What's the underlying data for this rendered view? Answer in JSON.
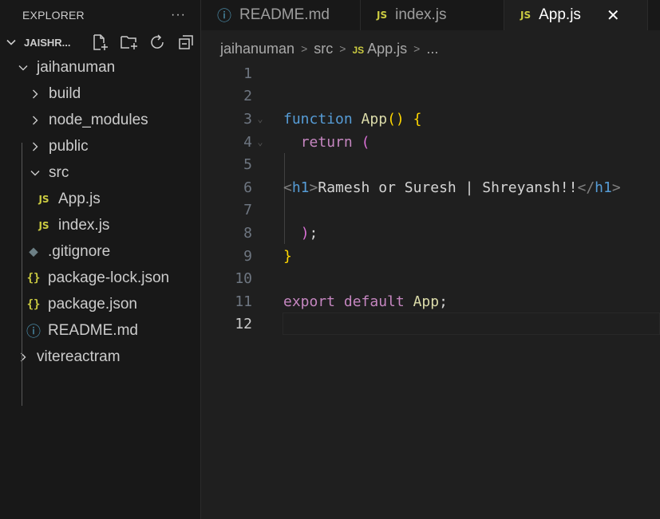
{
  "sidebar": {
    "title": "EXPLORER",
    "more": "···",
    "workspace": "JAISHR...",
    "tree": [
      {
        "label": "jaihanuman",
        "kind": "folder-open",
        "depth": 1
      },
      {
        "label": "build",
        "kind": "folder",
        "depth": 2
      },
      {
        "label": "node_modules",
        "kind": "folder",
        "depth": 2
      },
      {
        "label": "public",
        "kind": "folder",
        "depth": 2
      },
      {
        "label": "src",
        "kind": "folder-open",
        "depth": 2
      },
      {
        "label": "App.js",
        "kind": "js",
        "depth": 3
      },
      {
        "label": "index.js",
        "kind": "js",
        "depth": 3
      },
      {
        "label": ".gitignore",
        "kind": "git",
        "depth": 2
      },
      {
        "label": "package-lock.json",
        "kind": "json",
        "depth": 2
      },
      {
        "label": "package.json",
        "kind": "json",
        "depth": 2
      },
      {
        "label": "README.md",
        "kind": "info",
        "depth": 2
      },
      {
        "label": "vitereactram",
        "kind": "folder",
        "depth": 1
      }
    ]
  },
  "tabs": [
    {
      "label": "README.md",
      "icon": "info-icon"
    },
    {
      "label": "index.js",
      "icon": "js-icon"
    },
    {
      "label": "App.js",
      "icon": "js-icon",
      "active": true,
      "close": "✕"
    }
  ],
  "breadcrumb": [
    "jaihanuman",
    "src",
    "App.js",
    "..."
  ],
  "icons": {
    "js": "JS",
    "json": "{}",
    "info": "ⓘ",
    "git": "◆"
  },
  "editor": {
    "lines": [
      {
        "n": "1",
        "text": ""
      },
      {
        "n": "2",
        "text": ""
      },
      {
        "n": "3",
        "text": "function App() {"
      },
      {
        "n": "4",
        "text": "  return ("
      },
      {
        "n": "5",
        "text": ""
      },
      {
        "n": "6",
        "text": "<h1>Ramesh or Suresh | Shreyansh!!</h1>"
      },
      {
        "n": "7",
        "text": ""
      },
      {
        "n": "8",
        "text": "  );"
      },
      {
        "n": "9",
        "text": "}"
      },
      {
        "n": "10",
        "text": ""
      },
      {
        "n": "11",
        "text": "export default App;"
      },
      {
        "n": "12",
        "text": ""
      }
    ],
    "current_line": "12"
  },
  "colors": {
    "background": "#1f1f1f",
    "sidebar": "#181818",
    "keyword": "#569cd6",
    "control": "#c586c0",
    "function": "#dcdcaa",
    "bracket": "#ffd700",
    "js_icon": "#cbcb41"
  }
}
